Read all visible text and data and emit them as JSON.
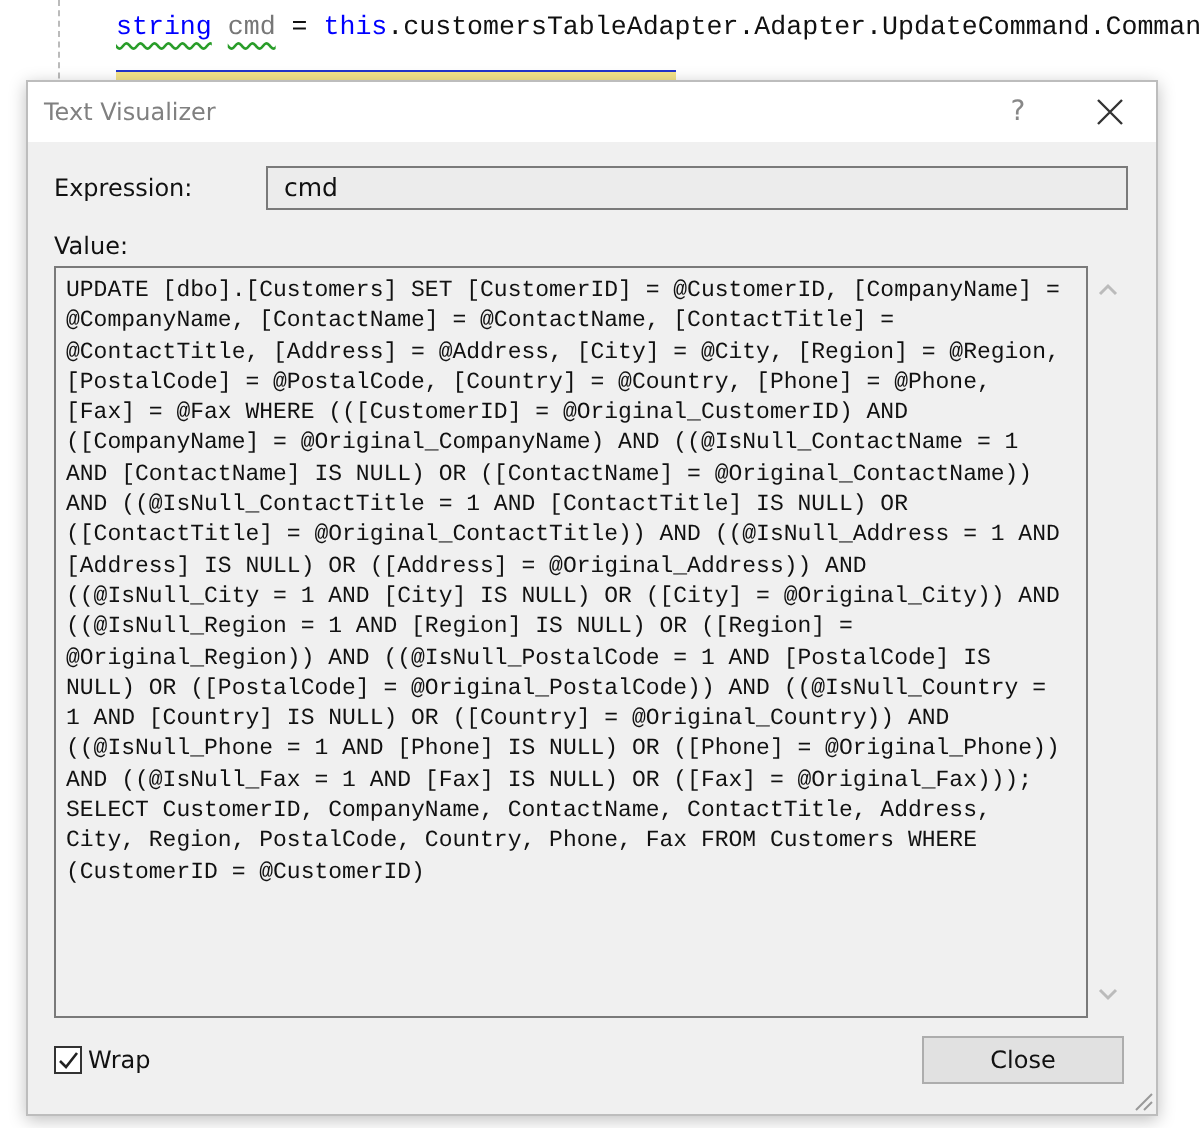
{
  "editor": {
    "code_line": [
      {
        "text": "string",
        "kind": "keyword",
        "squiggle": true
      },
      {
        "text": "cmd",
        "kind": "local",
        "squiggle": true
      },
      {
        "text": "=",
        "kind": "plain",
        "squiggle": false
      },
      {
        "text": "this",
        "kind": "keyword",
        "squiggle": false
      },
      {
        "text": ".customersTableAdapter.Adapter.UpdateCommand.Comman",
        "kind": "plain",
        "squiggle": false,
        "attached": true
      }
    ]
  },
  "dialog": {
    "title": "Text Visualizer",
    "help": "?",
    "expression_label": "Expression:",
    "expression_value": "cmd",
    "value_label": "Value:",
    "value_lines": [
      "UPDATE [dbo].[Customers] SET [CustomerID] = @CustomerID, [CompanyName] =",
      "@CompanyName, [ContactName] = @ContactName, [ContactTitle] =",
      "@ContactTitle, [Address] = @Address, [City] = @City, [Region] = @Region,",
      "[PostalCode] = @PostalCode, [Country] = @Country, [Phone] = @Phone,",
      "[Fax] = @Fax WHERE (([CustomerID] = @Original_CustomerID) AND",
      "([CompanyName] = @Original_CompanyName) AND ((@IsNull_ContactName = 1",
      "AND [ContactName] IS NULL) OR ([ContactName] = @Original_ContactName))",
      "AND ((@IsNull_ContactTitle = 1 AND [ContactTitle] IS NULL) OR",
      "([ContactTitle] = @Original_ContactTitle)) AND ((@IsNull_Address = 1 AND",
      "[Address] IS NULL) OR ([Address] = @Original_Address)) AND",
      "((@IsNull_City = 1 AND [City] IS NULL) OR ([City] = @Original_City)) AND",
      "((@IsNull_Region = 1 AND [Region] IS NULL) OR ([Region] =",
      "@Original_Region)) AND ((@IsNull_PostalCode = 1 AND [PostalCode] IS",
      "NULL) OR ([PostalCode] = @Original_PostalCode)) AND ((@IsNull_Country =",
      "1 AND [Country] IS NULL) OR ([Country] = @Original_Country)) AND",
      "((@IsNull_Phone = 1 AND [Phone] IS NULL) OR ([Phone] = @Original_Phone))",
      "AND ((@IsNull_Fax = 1 AND [Fax] IS NULL) OR ([Fax] = @Original_Fax)));",
      "SELECT CustomerID, CompanyName, ContactName, ContactTitle, Address,",
      "City, Region, PostalCode, Country, Phone, Fax FROM Customers WHERE",
      "(CustomerID = @CustomerID)"
    ],
    "wrap": {
      "label": "Wrap",
      "checked": true
    },
    "close_button": "Close"
  }
}
